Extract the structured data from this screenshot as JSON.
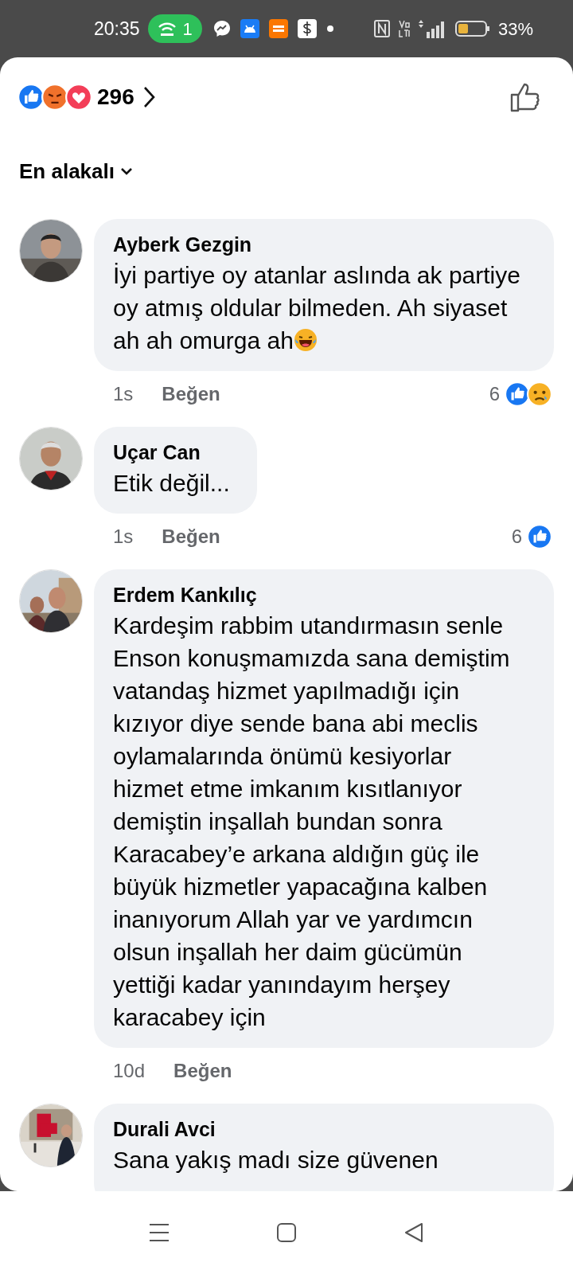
{
  "status_bar": {
    "time": "20:35",
    "hotspot_count": "1",
    "battery_percent": "33%"
  },
  "header": {
    "reactions": [
      {
        "kind": "like"
      },
      {
        "kind": "angry"
      },
      {
        "kind": "love"
      }
    ],
    "count": "296"
  },
  "sort": {
    "label": "En alakalı"
  },
  "comments": [
    {
      "author": "Ayberk Gezgin",
      "text": "İyi partiye oy atanlar aslında ak partiye oy atmış oldular bilmeden. Ah siyaset ah ah omurga ah",
      "trailing_emoji": {
        "kind": "laughing"
      },
      "time": "1s",
      "like_label": "Beğen",
      "reaction_count": "6",
      "reactions": [
        {
          "kind": "like"
        },
        {
          "kind": "sad"
        }
      ],
      "avatar": {
        "kind": "picture"
      }
    },
    {
      "author": "Uçar Can",
      "text": "Etik değil...",
      "time": "1s",
      "like_label": "Beğen",
      "reaction_count": "6",
      "reactions": [
        {
          "kind": "like"
        }
      ],
      "avatar": {
        "kind": "picture"
      }
    },
    {
      "author": "Erdem Kankılıç",
      "text": "Kardeşim rabbim utandırmasın senle Enson konuşmamızda sana demiştim vatandaş hizmet yapılmadığı için kızıyor diye sende bana abi meclis oylamalarında önümü kesiyorlar hizmet etme imkanım kısıtlanıyor demiştin inşallah bundan sonra Karacabey’e arkana aldığın güç ile büyük hizmetler yapacağına kalben inanıyorum Allah yar ve yardımcın olsun inşallah her daim gücümün yettiği kadar yanındayım herşey karacabey için",
      "time": "10d",
      "like_label": "Beğen",
      "avatar": {
        "kind": "picture"
      }
    },
    {
      "author": "Durali Avci",
      "text": "Sana yakış madı size güvenen",
      "cut_off": true,
      "avatar": {
        "kind": "picture"
      }
    }
  ]
}
